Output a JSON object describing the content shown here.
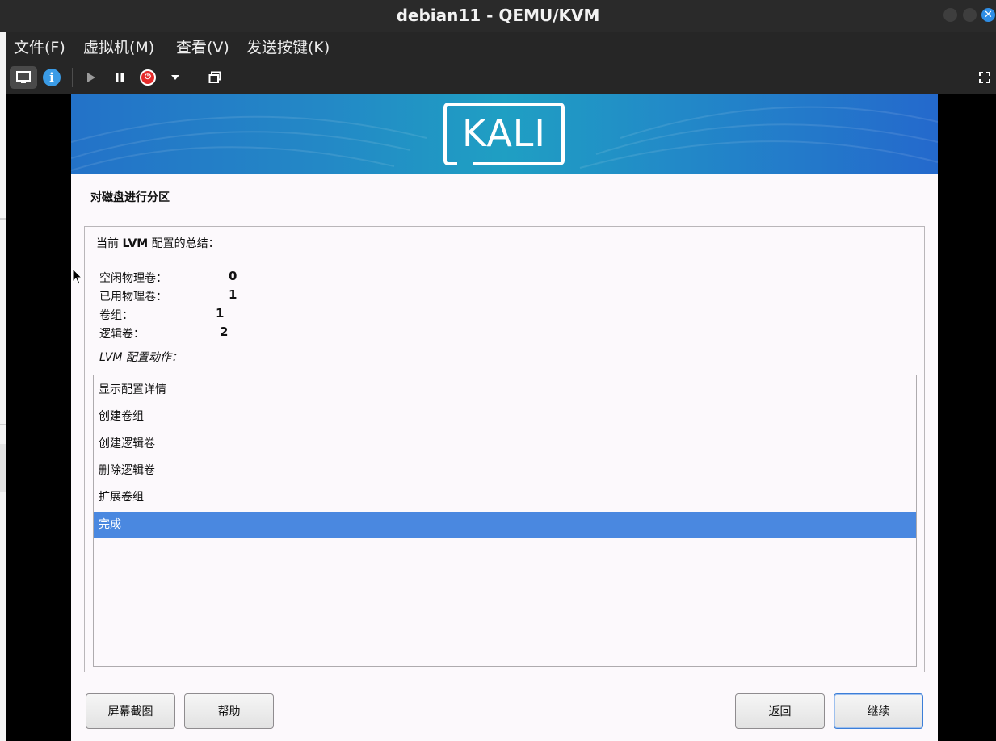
{
  "window": {
    "title": "debian11 - QEMU/KVM"
  },
  "menu": [
    "文件(F)",
    "虚拟机(M)",
    "查看(V)",
    "发送按键(K)"
  ],
  "toolbar": {
    "icons": [
      "display-icon",
      "info-icon",
      "play-icon",
      "pause-icon",
      "power-icon",
      "dropdown-icon",
      "screenshot-icon",
      "fullscreen-icon"
    ]
  },
  "installer": {
    "logo": "KALI",
    "heading": "对磁盘进行分区",
    "summary_prefix": "当前",
    "summary_bold": "LVM",
    "summary_suffix": "配置的总结：",
    "stats": [
      {
        "label": "空闲物理卷：",
        "value": "0"
      },
      {
        "label": "已用物理卷：",
        "value": "1"
      },
      {
        "label": "卷组：",
        "value": "1"
      },
      {
        "label": "逻辑卷：",
        "value": "2"
      }
    ],
    "actions_label": "LVM 配置动作：",
    "actions": [
      "显示配置详情",
      "创建卷组",
      "创建逻辑卷",
      "删除逻辑卷",
      "扩展卷组",
      "完成"
    ],
    "selected_action": "完成",
    "buttons": {
      "screenshot": "屏幕截图",
      "help": "帮助",
      "back": "返回",
      "continue": "继续"
    }
  },
  "colors": {
    "selection": "#4a88e0",
    "banner_start": "#2372c8",
    "banner_mid": "#1f9fc3",
    "close_button": "#2f8ee6",
    "power_button": "#e52b2b"
  }
}
